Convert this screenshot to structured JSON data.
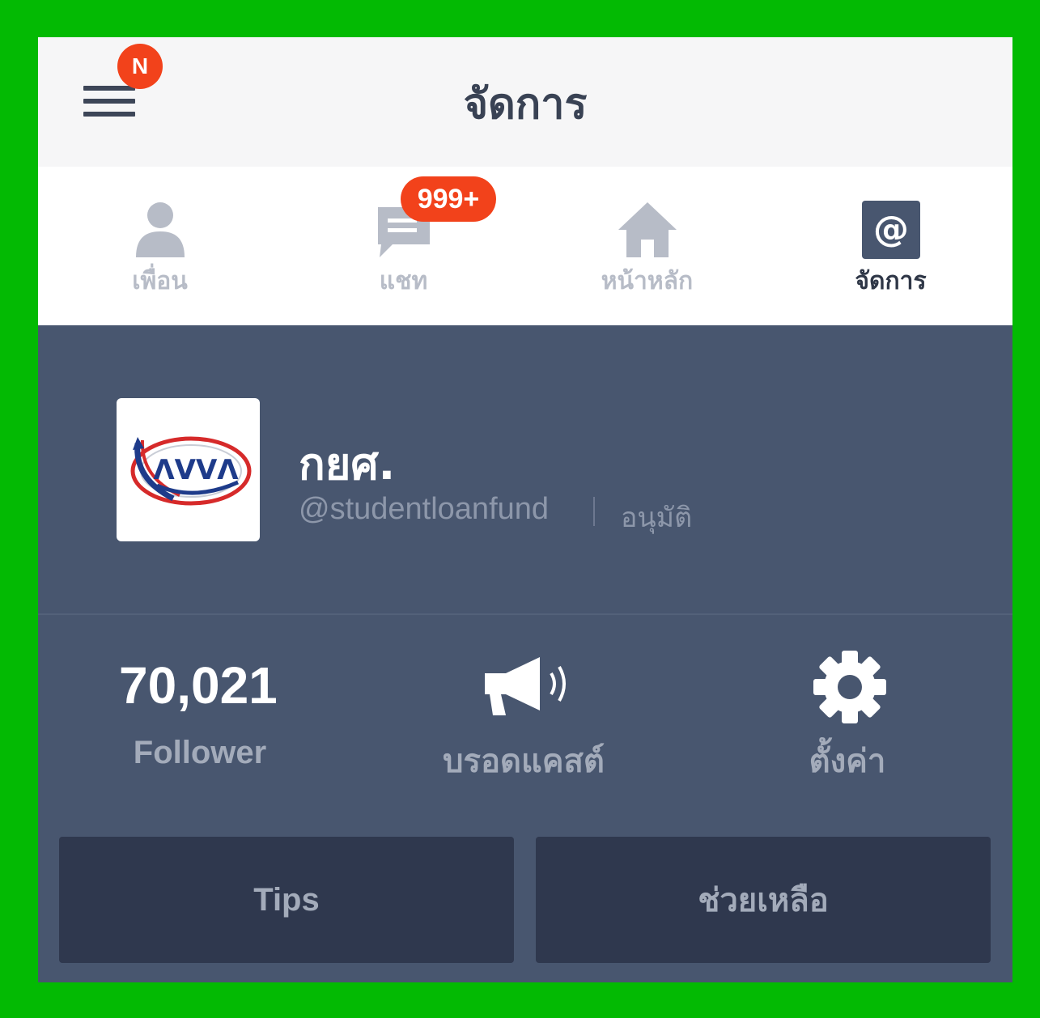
{
  "header": {
    "title": "จัดการ",
    "menu_badge": "N"
  },
  "tabs": [
    {
      "label": "เพื่อน",
      "icon": "friend-icon"
    },
    {
      "label": "แชท",
      "icon": "chat-icon",
      "badge": "999+"
    },
    {
      "label": "หน้าหลัก",
      "icon": "home-icon"
    },
    {
      "label": "จัดการ",
      "icon": "at-icon",
      "active": true
    }
  ],
  "profile": {
    "name": "กยศ.",
    "id": "@studentloanfund",
    "status": "อนุมัติ",
    "logo_text": "ΛVVΛ"
  },
  "stats": {
    "follower_count": "70,021",
    "follower_label": "Follower",
    "broadcast_label": "บรอดแคสต์",
    "settings_label": "ตั้งค่า"
  },
  "buttons": {
    "tips": "Tips",
    "help": "ช่วยเหลือ"
  },
  "colors": {
    "frame": "#03ba03",
    "panel": "#48566f",
    "button": "#2f384e",
    "badge": "#f2421b"
  }
}
